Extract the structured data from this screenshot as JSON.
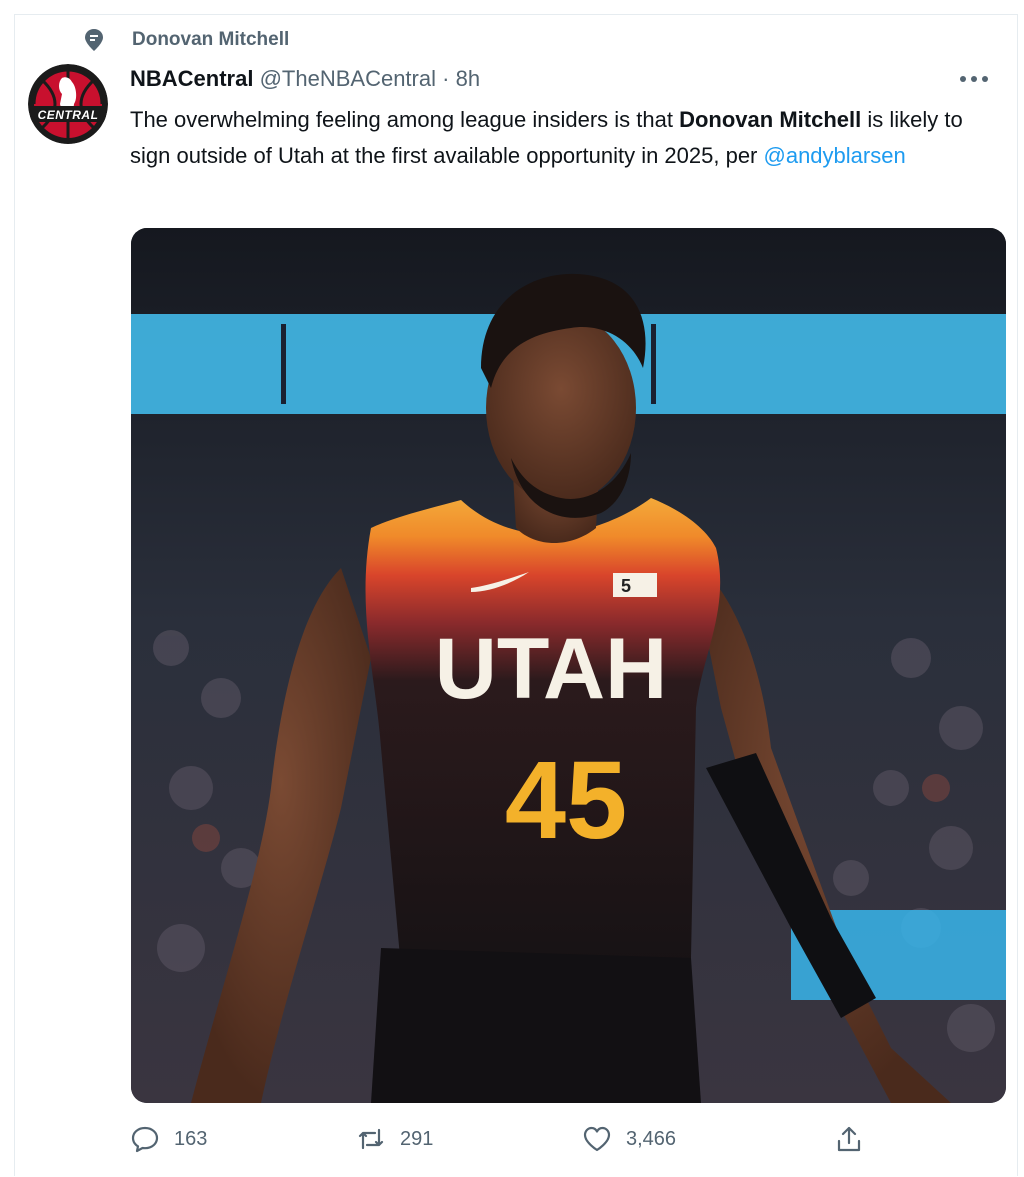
{
  "context": {
    "label": "Donovan Mitchell",
    "icon": "topic-pin-icon"
  },
  "author": {
    "name": "NBACentral",
    "handle": "@TheNBACentral",
    "separator": "·",
    "time": "8h",
    "avatar_text": "CENTRAL"
  },
  "tweet": {
    "text_part1": "The overwhelming feeling among league insiders is that ",
    "bold_name": "Donovan Mitchell",
    "text_part2": " is likely to sign outside of Utah at the first available opportunity in 2025, per ",
    "mention": "@andyblarsen"
  },
  "media": {
    "jersey_team": "UTAH",
    "jersey_number": "45",
    "patch_text": "5"
  },
  "actions": {
    "reply_count": "163",
    "retweet_count": "291",
    "like_count": "3,466"
  },
  "colors": {
    "accent": "#1d9bf0",
    "muted": "#536471",
    "text": "#0f1419"
  }
}
